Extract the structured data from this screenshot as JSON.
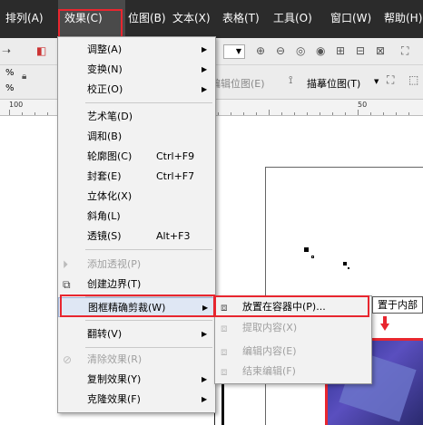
{
  "menubar": {
    "items": [
      {
        "label": "排列(A)"
      },
      {
        "label": "效果(C)"
      },
      {
        "label": "位图(B)"
      },
      {
        "label": "文本(X)"
      },
      {
        "label": "表格(T)"
      },
      {
        "label": "工具(O)"
      },
      {
        "label": "窗口(W)"
      },
      {
        "label": "帮助(H)"
      }
    ]
  },
  "toolbar": {
    "edit_bitmap_label": "编辑位图(E)",
    "trace_bitmap_label": "描摹位图(T)",
    "percent_1": "%",
    "percent_2": "%"
  },
  "ruler": {
    "label_100": "100",
    "label_50": "50"
  },
  "effects_menu": {
    "items": [
      {
        "label": "调整(A)",
        "submenu": true,
        "enabled": true
      },
      {
        "label": "变换(N)",
        "submenu": true,
        "enabled": true
      },
      {
        "label": "校正(O)",
        "submenu": true,
        "enabled": true
      },
      {
        "label": "艺术笔(D)",
        "enabled": true
      },
      {
        "label": "调和(B)",
        "enabled": true
      },
      {
        "label": "轮廓图(C)",
        "accel": "Ctrl+F9",
        "enabled": true
      },
      {
        "label": "封套(E)",
        "accel": "Ctrl+F7",
        "enabled": true
      },
      {
        "label": "立体化(X)",
        "enabled": true
      },
      {
        "label": "斜角(L)",
        "enabled": true
      },
      {
        "label": "透镜(S)",
        "accel": "Alt+F3",
        "enabled": true
      },
      {
        "label": "添加透视(P)",
        "enabled": false
      },
      {
        "label": "创建边界(T)",
        "enabled": true
      },
      {
        "label": "图框精确剪裁(W)",
        "submenu": true,
        "enabled": true,
        "highlighted": true
      },
      {
        "label": "翻转(V)",
        "submenu": true,
        "enabled": true
      },
      {
        "label": "清除效果(R)",
        "enabled": false
      },
      {
        "label": "复制效果(Y)",
        "submenu": true,
        "enabled": true
      },
      {
        "label": "克隆效果(F)",
        "submenu": true,
        "enabled": true
      }
    ]
  },
  "powerclip_submenu": {
    "items": [
      {
        "label": "放置在容器中(P)...",
        "enabled": true
      },
      {
        "label": "提取内容(X)",
        "enabled": false
      },
      {
        "label": "编辑内容(E)",
        "enabled": false
      },
      {
        "label": "结束编辑(F)",
        "enabled": false
      }
    ]
  },
  "tooltip": {
    "text": "置于内部"
  },
  "colors": {
    "highlight": "#e8262f",
    "menubar": "#2b2b2b",
    "menu_bg": "#f2f2f2",
    "disabled_text": "#a0a0a0"
  }
}
